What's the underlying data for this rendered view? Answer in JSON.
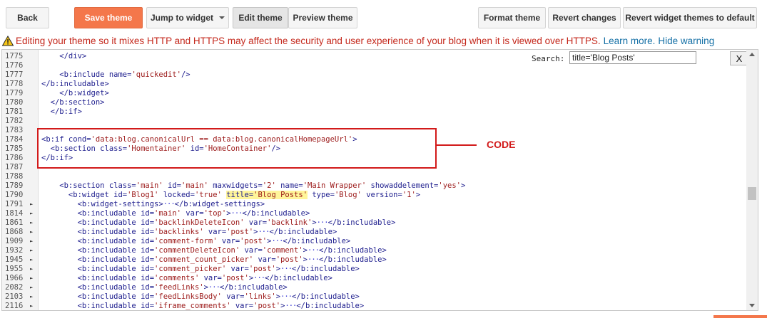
{
  "toolbar": {
    "back_label": "Back",
    "save_label": "Save theme",
    "jump_label": "Jump to widget",
    "edit_label": "Edit theme",
    "preview_label": "Preview theme",
    "format_label": "Format theme",
    "revert_label": "Revert changes",
    "revert_widgets_label": "Revert widget themes to default"
  },
  "warning": {
    "icon": "warning-triangle-icon",
    "text": "Editing your theme so it mixes HTTP and HTTPS may affect the security and user experience of your blog when it is viewed over HTTPS.",
    "learn_more": "Learn more.",
    "hide": "Hide warning"
  },
  "search": {
    "label": "Search:",
    "value": "title='Blog Posts'",
    "close_label": "X"
  },
  "annotation": {
    "label": "CODE"
  },
  "colors": {
    "accent": "#f4774b",
    "warning": "#c4281c",
    "annotation": "#d21a1a",
    "highlight": "#fff59a"
  },
  "lines": [
    {
      "num": "1775",
      "fold": "",
      "code": "    </div>"
    },
    {
      "num": "1776",
      "fold": "",
      "code": ""
    },
    {
      "num": "1777",
      "fold": "",
      "code": "    <b:include name='quickedit'/>"
    },
    {
      "num": "1778",
      "fold": "",
      "code": "</b:includable>"
    },
    {
      "num": "1779",
      "fold": "",
      "code": "    </b:widget>"
    },
    {
      "num": "1780",
      "fold": "",
      "code": "  </b:section>"
    },
    {
      "num": "1781",
      "fold": "",
      "code": "  </b:if>"
    },
    {
      "num": "1782",
      "fold": "",
      "code": ""
    },
    {
      "num": "1783",
      "fold": "",
      "code": ""
    },
    {
      "num": "1784",
      "fold": "",
      "code": "<b:if cond='data:blog.canonicalUrl == data:blog.canonicalHomepageUrl'>"
    },
    {
      "num": "1785",
      "fold": "",
      "code": "  <b:section class='Homentainer' id='HomeContainer'/>"
    },
    {
      "num": "1786",
      "fold": "",
      "code": "</b:if>"
    },
    {
      "num": "1787",
      "fold": "",
      "code": ""
    },
    {
      "num": "1788",
      "fold": "",
      "code": ""
    },
    {
      "num": "1789",
      "fold": "",
      "code": "    <b:section class='main' id='main' maxwidgets='2' name='Main Wrapper' showaddelement='yes'>"
    },
    {
      "num": "1790",
      "fold": "",
      "code": "      <b:widget id='Blog1' locked='true' title='Blog Posts' type='Blog' version='1'>",
      "hl": "title='Blog Posts'"
    },
    {
      "num": "1791",
      "fold": "►",
      "code": "        <b:widget-settings>···</b:widget-settings>"
    },
    {
      "num": "1814",
      "fold": "►",
      "code": "        <b:includable id='main' var='top'>···</b:includable>"
    },
    {
      "num": "1861",
      "fold": "►",
      "code": "        <b:includable id='backlinkDeleteIcon' var='backlink'>···</b:includable>"
    },
    {
      "num": "1868",
      "fold": "►",
      "code": "        <b:includable id='backlinks' var='post'>···</b:includable>"
    },
    {
      "num": "1909",
      "fold": "►",
      "code": "        <b:includable id='comment-form' var='post'>···</b:includable>"
    },
    {
      "num": "1932",
      "fold": "►",
      "code": "        <b:includable id='commentDeleteIcon' var='comment'>···</b:includable>"
    },
    {
      "num": "1945",
      "fold": "►",
      "code": "        <b:includable id='comment_count_picker' var='post'>···</b:includable>"
    },
    {
      "num": "1955",
      "fold": "►",
      "code": "        <b:includable id='comment_picker' var='post'>···</b:includable>"
    },
    {
      "num": "1966",
      "fold": "►",
      "code": "        <b:includable id='comments' var='post'>···</b:includable>"
    },
    {
      "num": "2082",
      "fold": "►",
      "code": "        <b:includable id='feedLinks'>···</b:includable>"
    },
    {
      "num": "2103",
      "fold": "►",
      "code": "        <b:includable id='feedLinksBody' var='links'>···</b:includable>"
    },
    {
      "num": "2116",
      "fold": "►",
      "code": "        <b:includable id='iframe_comments' var='post'>···</b:includable>"
    }
  ]
}
